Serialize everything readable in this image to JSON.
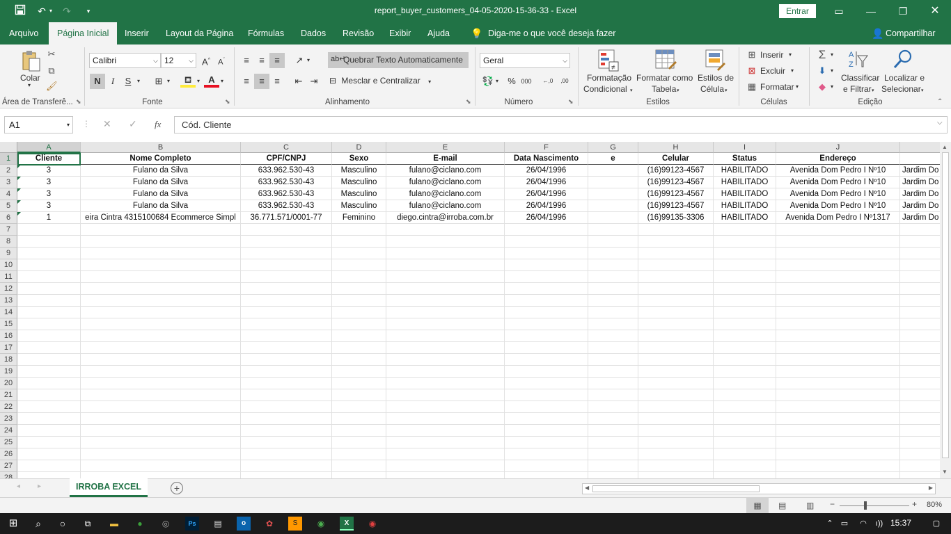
{
  "window": {
    "title": "report_buyer_customers_04-05-2020-15-36-33  -  Excel",
    "signin_label": "Entrar"
  },
  "tabs": [
    "Arquivo",
    "Página Inicial",
    "Inserir",
    "Layout da Página",
    "Fórmulas",
    "Dados",
    "Revisão",
    "Exibir",
    "Ajuda"
  ],
  "tell_me": "Diga-me o que você deseja fazer",
  "share_label": "Compartilhar",
  "ribbon": {
    "paste_label": "Colar",
    "font_name": "Calibri",
    "font_size": "12",
    "bold": "N",
    "italic": "I",
    "underline": "S",
    "wrap_text": "Quebrar Texto Automaticamente",
    "merge_center": "Mesclar e Centralizar",
    "number_format": "Geral",
    "cond_format_1": "Formatação",
    "cond_format_2": "Condicional",
    "format_table_1": "Formatar como",
    "format_table_2": "Tabela",
    "cell_styles_1": "Estilos de",
    "cell_styles_2": "Célula",
    "insert": "Inserir",
    "delete": "Excluir",
    "format": "Formatar",
    "sort_1": "Classificar",
    "sort_2": "e Filtrar",
    "find_1": "Localizar e",
    "find_2": "Selecionar",
    "groups": {
      "clipboard": "Área de Transferê...",
      "font": "Fonte",
      "alignment": "Alinhamento",
      "number": "Número",
      "styles": "Estilos",
      "cells": "Células",
      "editing": "Edição"
    }
  },
  "formula_bar": {
    "name_box": "A1",
    "content": "Cód. Cliente"
  },
  "sheet": {
    "columns": [
      "A",
      "B",
      "C",
      "D",
      "E",
      "F",
      "G",
      "H",
      "I",
      "J"
    ],
    "header_row": [
      "Cliente",
      "Nome Completo",
      "CPF/CNPJ",
      "Sexo",
      "E-mail",
      "Data Nascimento",
      "e",
      "Celular",
      "Status",
      "Endereço"
    ],
    "rows": [
      [
        "3",
        "Fulano da Silva",
        "633.962.530-43",
        "Masculino",
        "fulano@ciclano.com",
        "26/04/1996",
        "",
        "(16)99123-4567",
        "HABILITADO",
        "Avenida Dom Pedro I Nº10",
        "Jardim Do"
      ],
      [
        "3",
        "Fulano da Silva",
        "633.962.530-43",
        "Masculino",
        "fulano@ciclano.com",
        "26/04/1996",
        "",
        "(16)99123-4567",
        "HABILITADO",
        "Avenida Dom Pedro I Nº10",
        "Jardim Do"
      ],
      [
        "3",
        "Fulano da Silva",
        "633.962.530-43",
        "Masculino",
        "fulano@ciclano.com",
        "26/04/1996",
        "",
        "(16)99123-4567",
        "HABILITADO",
        "Avenida Dom Pedro I Nº10",
        "Jardim Do"
      ],
      [
        "3",
        "Fulano da Silva",
        "633.962.530-43",
        "Masculino",
        "fulano@ciclano.com",
        "26/04/1996",
        "",
        "(16)99123-4567",
        "HABILITADO",
        "Avenida Dom Pedro I Nº10",
        "Jardim Do"
      ],
      [
        "1",
        "eira Cintra 4315100684 Ecommerce Simpl",
        "36.771.571/0001-77",
        "Feminino",
        "diego.cintra@irroba.com.br",
        "26/04/1996",
        "",
        "(16)99135-3306",
        "HABILITADO",
        "Avenida Dom Pedro I Nº1317",
        "Jardim Do"
      ]
    ],
    "row_numbers": [
      "1",
      "2",
      "3",
      "4",
      "5",
      "6",
      "7",
      "8",
      "9",
      "10",
      "11",
      "12",
      "13",
      "14",
      "15",
      "16",
      "17",
      "18",
      "19",
      "20",
      "21",
      "22",
      "23",
      "24",
      "25",
      "26",
      "27",
      "28"
    ],
    "tab_name": "IRROBA EXCEL"
  },
  "status": {
    "zoom": "80%"
  },
  "taskbar": {
    "time": "15:37",
    "volume": "ı))"
  },
  "colors": {
    "accent": "#217346",
    "ribbon_bg": "#f3f3f3",
    "header_bg": "#e6e6e6"
  }
}
